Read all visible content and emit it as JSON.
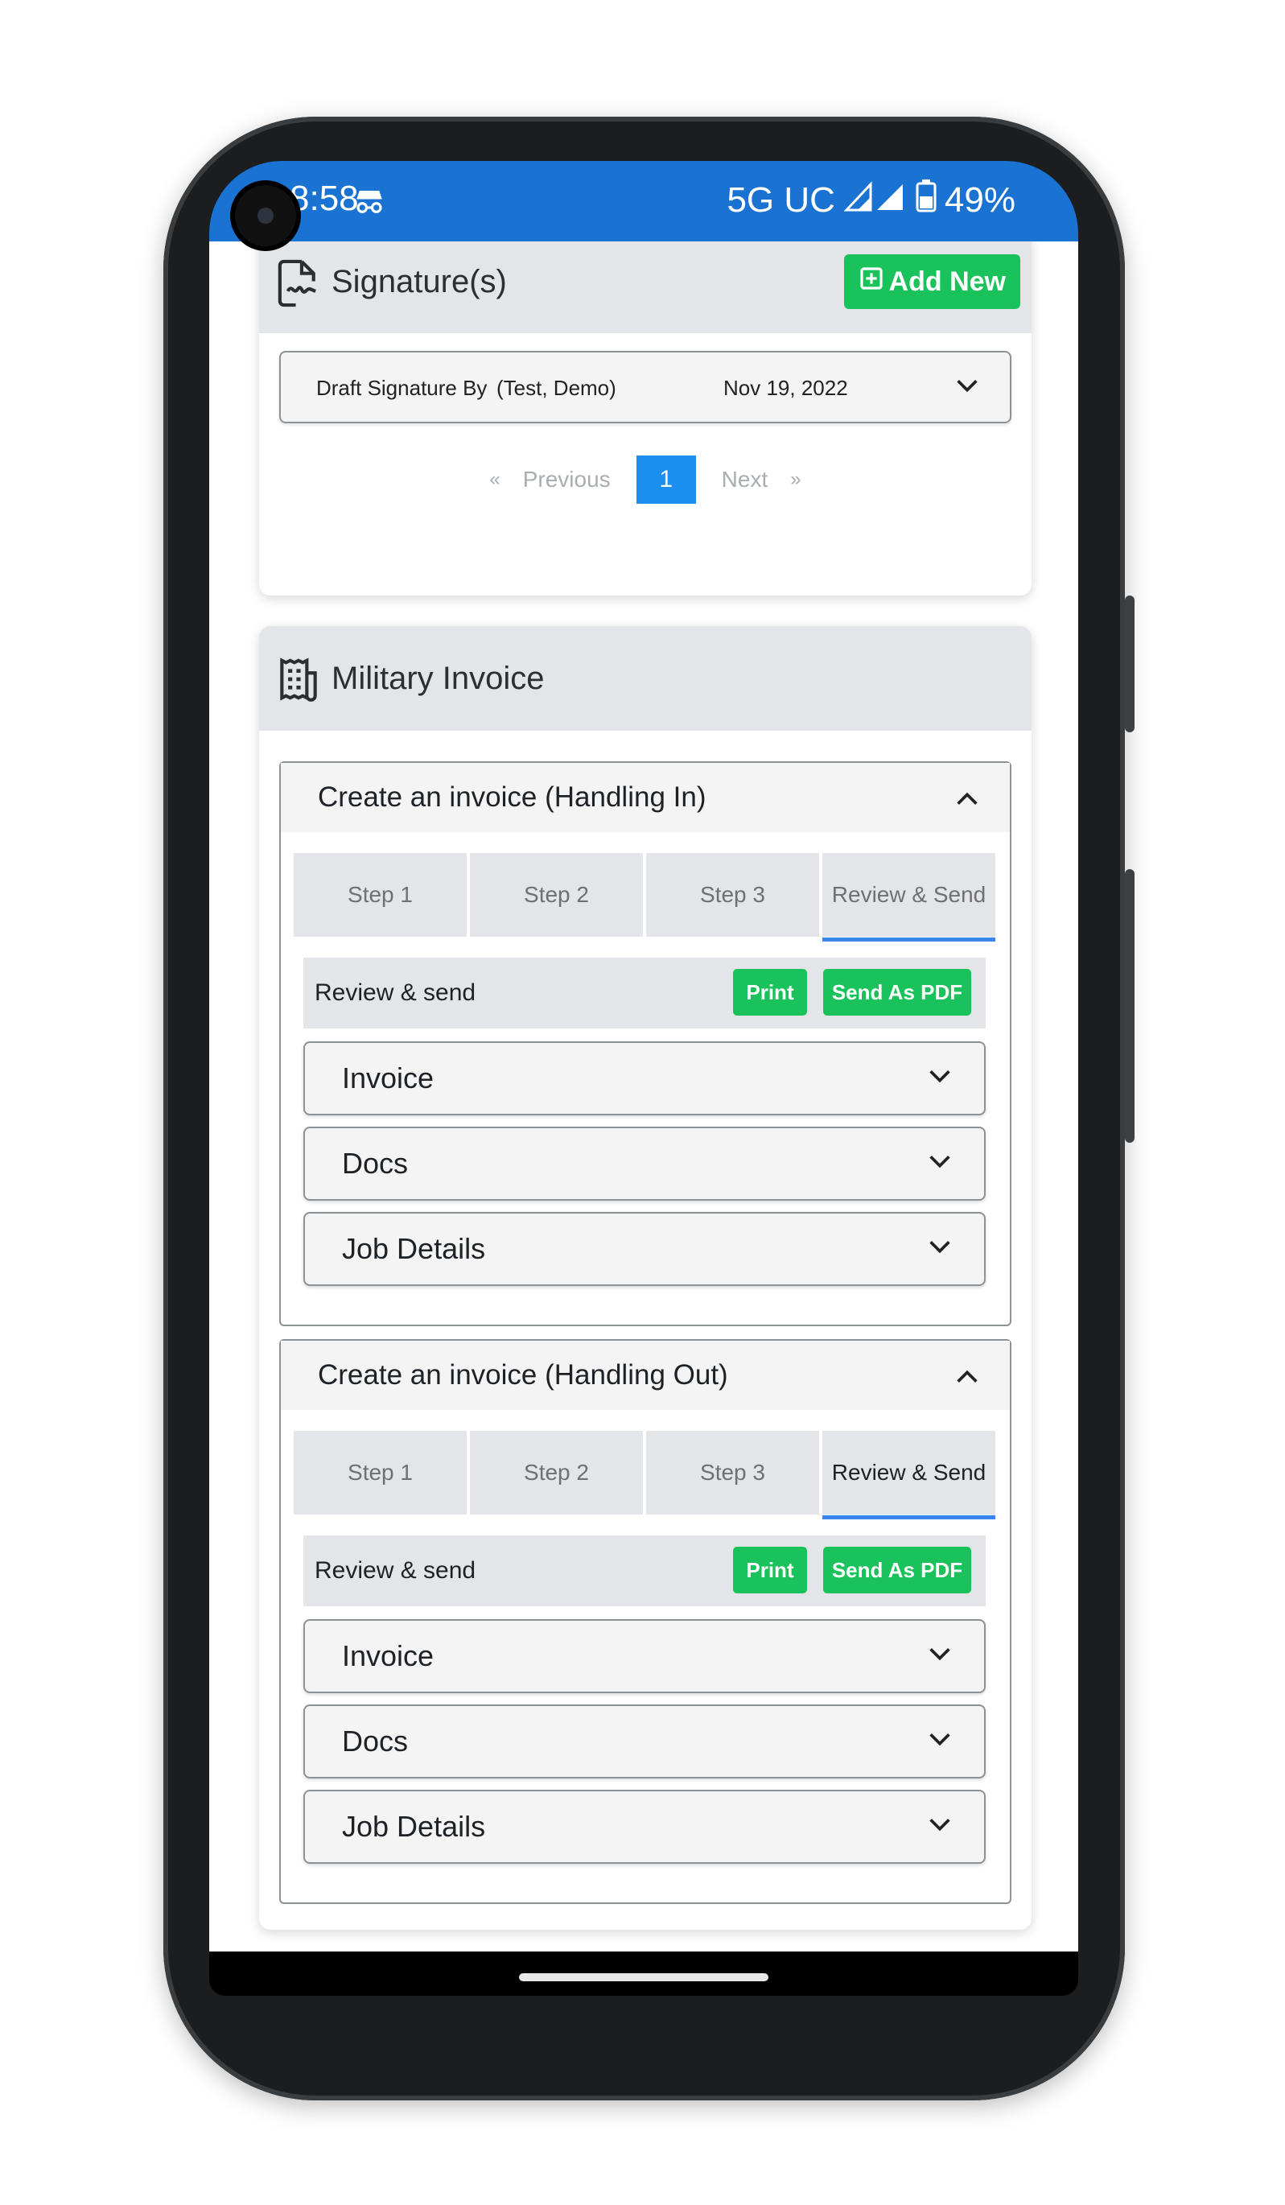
{
  "status_bar": {
    "time": "8:58",
    "network": "5G UC",
    "battery": "49%"
  },
  "signatures": {
    "title": "Signature(s)",
    "add_button": "Add New",
    "entry": {
      "label": "Draft Signature By",
      "name": "(Test, Demo)",
      "date": "Nov 19, 2022"
    },
    "pagination": {
      "prev_symbol": "«",
      "prev": "Previous",
      "current": "1",
      "next": "Next",
      "next_symbol": "»"
    }
  },
  "military_invoice": {
    "title": "Military Invoice",
    "sections": [
      {
        "title": "Create an invoice (Handling In)",
        "tabs": [
          "Step 1",
          "Step 2",
          "Step 3",
          "Review & Send"
        ],
        "active_tab": 3,
        "review_title": "Review & send",
        "print_label": "Print",
        "pdf_label": "Send As PDF",
        "items": [
          "Invoice",
          "Docs",
          "Job Details"
        ]
      },
      {
        "title": "Create an invoice (Handling Out)",
        "tabs": [
          "Step 1",
          "Step 2",
          "Step 3",
          "Review & Send"
        ],
        "active_tab": 3,
        "review_title": "Review & send",
        "print_label": "Print",
        "pdf_label": "Send As PDF",
        "items": [
          "Invoice",
          "Docs",
          "Job Details"
        ]
      }
    ]
  },
  "colors": {
    "status_bar": "#1a73d2",
    "accent_green": "#19c25a",
    "active_page": "#1d8ff0",
    "active_tab_underline": "#3b86ee"
  },
  "icons": [
    "incognito-icon",
    "signal-icon",
    "battery-icon",
    "signature-document-icon",
    "plus-square-icon",
    "chevron-down-icon",
    "chevron-up-icon",
    "invoice-receipt-icon"
  ]
}
